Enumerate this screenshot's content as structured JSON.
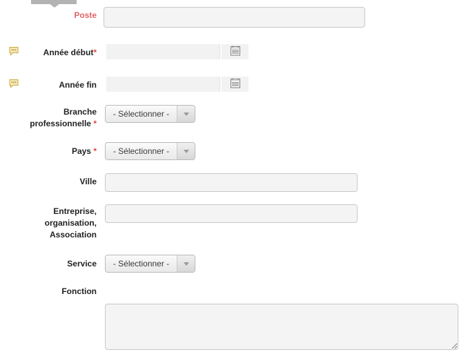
{
  "panel": {
    "tab_indicator": "tab-pointer"
  },
  "fields": {
    "poste": {
      "label": "Poste",
      "value": "",
      "placeholder": ""
    },
    "annee_debut": {
      "label": "Année début",
      "required_marker": "*",
      "value": "",
      "placeholder": "",
      "note_icon": "comment-bubble-icon",
      "picker_icon": "calendar-icon"
    },
    "annee_fin": {
      "label": "Année fin",
      "value": "",
      "placeholder": "",
      "note_icon": "comment-bubble-icon",
      "picker_icon": "calendar-icon"
    },
    "branche": {
      "label_line1": "Branche",
      "label_line2": "professionnelle",
      "required_marker": "*",
      "selected": "- Sélectionner -"
    },
    "pays": {
      "label": "Pays",
      "required_marker": "*",
      "selected": "- Sélectionner -"
    },
    "ville": {
      "label": "Ville",
      "value": "",
      "placeholder": ""
    },
    "entreprise": {
      "label_line1": "Entreprise,",
      "label_line2": "organisation,",
      "label_line3": "Association",
      "value": "",
      "placeholder": ""
    },
    "service": {
      "label": "Service",
      "selected": "- Sélectionner -"
    },
    "fonction": {
      "label": "Fonction",
      "value": "",
      "placeholder": ""
    }
  },
  "colors": {
    "error_label": "#e06666",
    "required_star": "#e8433c",
    "label_text": "#222222",
    "input_bg": "#f4f4f4",
    "input_border": "#c8c8c8",
    "flat_input_bg": "#f2f2f2",
    "tab_gray": "#b3b3b3",
    "note_icon_fill": "#f0e0a8"
  }
}
